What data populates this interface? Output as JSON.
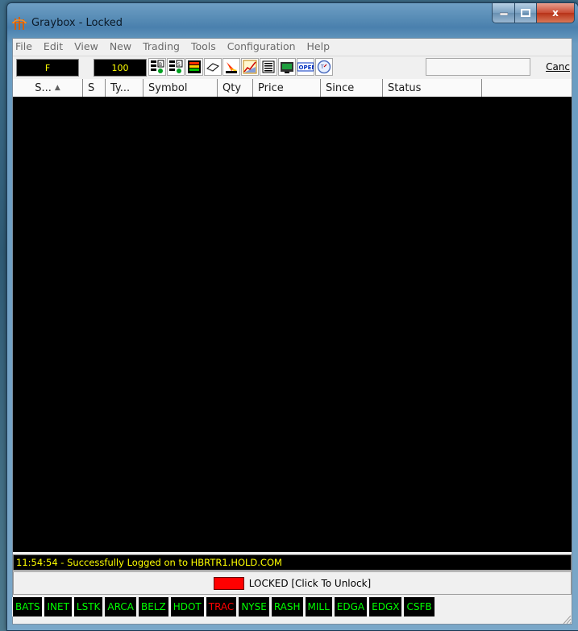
{
  "window": {
    "title": "Graybox - Locked",
    "close_glyph": "x"
  },
  "menu": [
    {
      "label": "File"
    },
    {
      "label": "Edit"
    },
    {
      "label": "View"
    },
    {
      "label": "New"
    },
    {
      "label": "Trading"
    },
    {
      "label": "Tools"
    },
    {
      "label": "Configuration"
    },
    {
      "label": "Help"
    }
  ],
  "toolbar": {
    "side_value": "F",
    "quantity_value": "100",
    "cancel_label": "Canc",
    "icons": [
      "buy-order-icon",
      "sell-order-icon",
      "color-grid-icon",
      "eraser-icon",
      "rocket-icon",
      "chart-icon",
      "list-icon",
      "monitor-icon",
      "open-sign-icon",
      "clock-icon"
    ],
    "open_icon_text": "OPEN"
  },
  "grid": {
    "columns": [
      "S...",
      "S",
      "Ty...",
      "Symbol",
      "Qty",
      "Price",
      "Since",
      "Status"
    ],
    "sorted_column_index": 0,
    "rows": []
  },
  "status_message": "11:54:54 - Successfully Logged on to HBRTR1.HOLD.COM",
  "lock": {
    "label": "LOCKED [Click To Unlock]",
    "swatch_color": "#ff0000"
  },
  "venues": [
    {
      "name": "BATS",
      "color": "#00ff00"
    },
    {
      "name": "INET",
      "color": "#00ff00"
    },
    {
      "name": "LSTK",
      "color": "#00ff00"
    },
    {
      "name": "ARCA",
      "color": "#00ff00"
    },
    {
      "name": "BELZ",
      "color": "#00ff00"
    },
    {
      "name": "HDOT",
      "color": "#00ff00"
    },
    {
      "name": "TRAC",
      "color": "#ff0000"
    },
    {
      "name": "NYSE",
      "color": "#00ff00"
    },
    {
      "name": "RASH",
      "color": "#00ff00"
    },
    {
      "name": "MILL",
      "color": "#00ff00"
    },
    {
      "name": "EDGA",
      "color": "#00ff00"
    },
    {
      "name": "EDGX",
      "color": "#00ff00"
    },
    {
      "name": "CSFB",
      "color": "#00ff00"
    }
  ]
}
